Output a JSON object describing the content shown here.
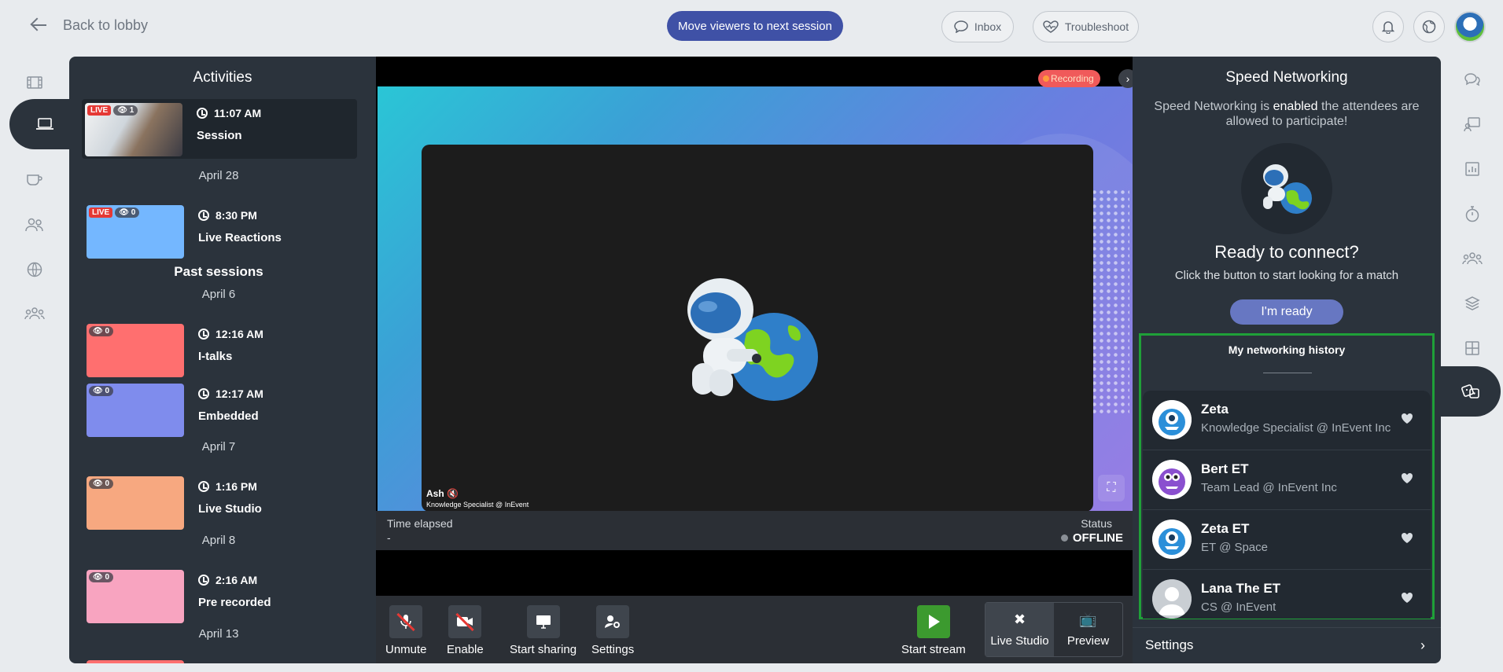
{
  "topbar": {
    "back_label": "Back to lobby",
    "move_viewers_label": "Move viewers to next session",
    "inbox_label": "Inbox",
    "troubleshoot_label": "Troubleshoot"
  },
  "activities": {
    "title": "Activities",
    "past_sessions_label": "Past sessions",
    "sessions": [
      {
        "live": "LIVE",
        "views": "1",
        "time": "11:07 AM",
        "title": "Session",
        "color": "#dfe3e6"
      },
      {
        "live": "LIVE",
        "views": "0",
        "time": "8:30 PM",
        "title": "Live Reactions",
        "color": "#74b7ff"
      },
      {
        "views": "0",
        "time": "12:16 AM",
        "title": "I-talks",
        "color": "#ff6f6f"
      },
      {
        "views": "0",
        "time": "12:17 AM",
        "title": "Embedded",
        "color": "#7f8ced"
      },
      {
        "views": "0",
        "time": "1:16 PM",
        "title": "Live Studio",
        "color": "#f7a880"
      },
      {
        "views": "0",
        "time": "2:16 AM",
        "title": "Pre recorded",
        "color": "#f8a4c0"
      }
    ],
    "dates": [
      "April 28",
      "April 6",
      "April 7",
      "April 8",
      "April 13"
    ]
  },
  "stage": {
    "recording_label": "Recording",
    "speaker_name": "Ash",
    "speaker_role": "Knowledge Specialist @ InEvent",
    "time_elapsed_label": "Time elapsed",
    "time_elapsed_value": "-",
    "status_label": "Status",
    "status_value": "OFFLINE",
    "controls": {
      "unmute": "Unmute",
      "enable": "Enable",
      "start_sharing": "Start sharing",
      "settings": "Settings",
      "start_stream": "Start stream",
      "live_studio": "Live Studio",
      "preview": "Preview"
    }
  },
  "speed_networking": {
    "title": "Speed Networking",
    "sub_pre": "Speed Networking is",
    "sub_bold": "enabled",
    "sub_post": "the attendees are allowed to participate!",
    "ready_title": "Ready to connect?",
    "ready_sub": "Click the button to start looking for a match",
    "ready_button": "I'm ready",
    "history_title": "My networking history",
    "history": [
      {
        "name": "Zeta",
        "role": "Knowledge Specialist @ InEvent Inc",
        "avatar": "blue-monster"
      },
      {
        "name": "Bert ET",
        "role": "Team Lead @ InEvent Inc",
        "avatar": "purple-monster"
      },
      {
        "name": "Zeta ET",
        "role": "ET @ Space",
        "avatar": "blue-monster"
      },
      {
        "name": "Lana The ET",
        "role": "CS @ InEvent",
        "avatar": "default-person"
      }
    ],
    "settings_label": "Settings"
  },
  "colors": {
    "accent": "#3f51a6",
    "panel": "#2b333c",
    "highlight_border": "#1fa038",
    "live_badge": "#e53935"
  }
}
